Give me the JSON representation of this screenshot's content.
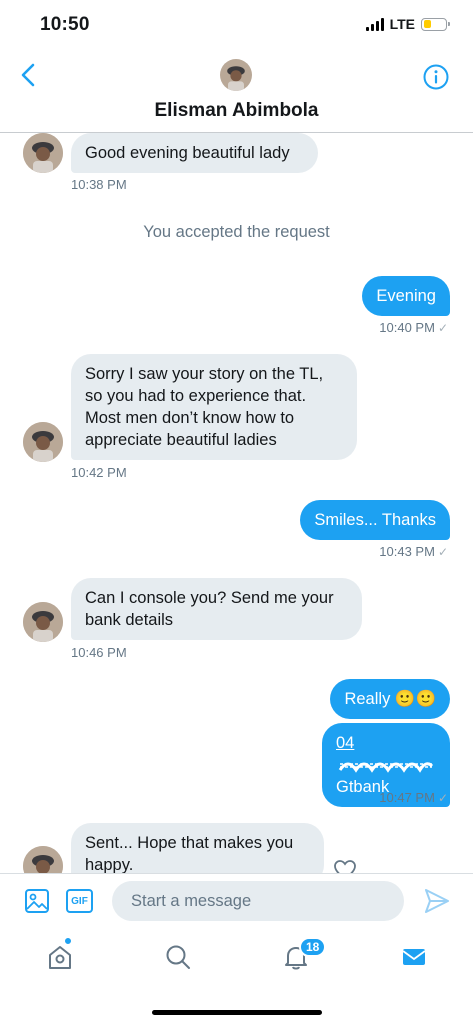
{
  "status_bar": {
    "time": "10:50",
    "network": "LTE",
    "battery_percent": 35
  },
  "header": {
    "contact_name": "Elisman Abimbola",
    "back_icon": "chevron-left-icon",
    "info_icon": "info-icon"
  },
  "messages": [
    {
      "direction": "in",
      "text": "Good evening beautiful lady",
      "time": "10:38 PM"
    },
    {
      "direction": "system",
      "text": "You accepted the request"
    },
    {
      "direction": "out",
      "text": "Evening",
      "time": "10:40 PM"
    },
    {
      "direction": "in",
      "lines": [
        "Sorry I saw your story on the TL,",
        "so you had to experience that.",
        "Most men don’t know how to",
        "appreciate beautiful ladies"
      ],
      "time": "10:42 PM"
    },
    {
      "direction": "out",
      "text": "Smiles... Thanks",
      "time": "10:43 PM"
    },
    {
      "direction": "in",
      "lines": [
        "Can I console you? Send me your",
        "bank details"
      ],
      "time": "10:46 PM"
    },
    {
      "direction": "out",
      "text": "Really 🙂🙂"
    },
    {
      "direction": "out",
      "account_visible": "04",
      "bank": "Gtbank",
      "time": "10:47 PM"
    },
    {
      "direction": "in",
      "lines": [
        "Sent... Hope that makes you",
        "happy."
      ]
    }
  ],
  "composer": {
    "placeholder": "Start a message",
    "gif_label": "GIF"
  },
  "tabbar": {
    "notifications_count": "18"
  },
  "colors": {
    "accent": "#1da1f2",
    "incoming_bubble": "#e6ecf0",
    "meta_text": "#657786"
  }
}
